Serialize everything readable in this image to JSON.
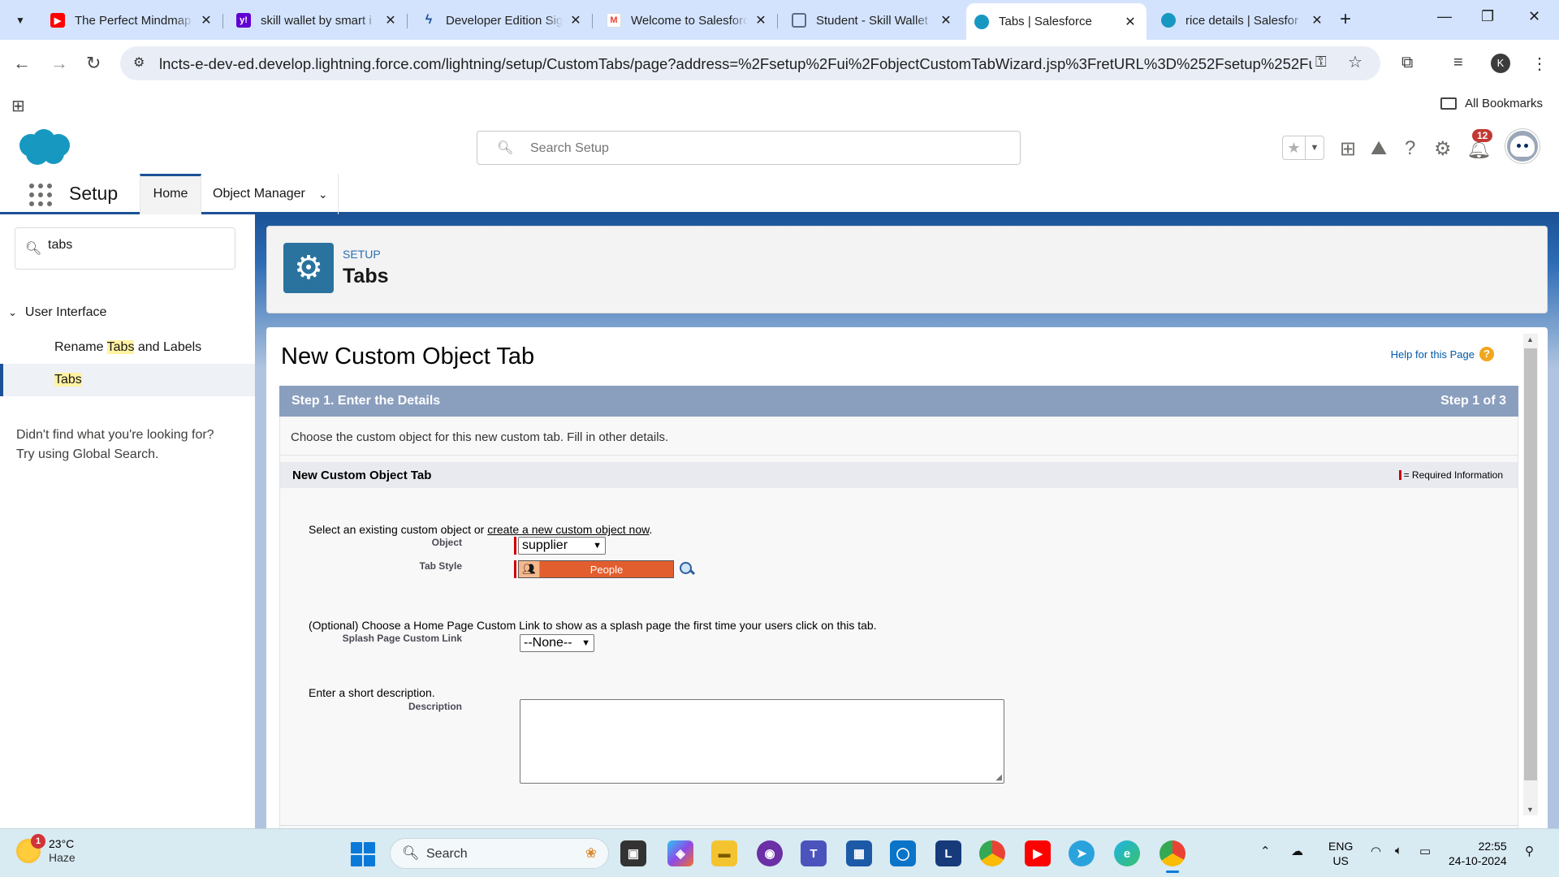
{
  "browser": {
    "tabs": [
      {
        "title": "The Perfect Mindmap",
        "icon": "youtube-icon",
        "color": "#ff0000"
      },
      {
        "title": "skill wallet by smart i",
        "icon": "yahoo-icon",
        "color": "#6001d2"
      },
      {
        "title": "Developer Edition Sig",
        "icon": "bolt-icon",
        "color": "#1b5297"
      },
      {
        "title": "Welcome to Salesforc",
        "icon": "gmail-icon",
        "color": "#ea4335"
      },
      {
        "title": "Student - Skill Wallet",
        "icon": "page-icon",
        "color": "#5a6b8c"
      },
      {
        "title": "Tabs | Salesforce",
        "icon": "salesforce-cloud-icon",
        "color": "#1798c1",
        "active": true
      },
      {
        "title": "rice details | Salesfor",
        "icon": "salesforce-cloud-icon",
        "color": "#1798c1"
      }
    ],
    "url": "lncts-e-dev-ed.develop.lightning.force.com/lightning/setup/CustomTabs/page?address=%2Fsetup%2Fui%2FobjectCustomTabWizard.jsp%3FretURL%3D%252Fsetup%252Fui%252Fc...",
    "profile_initial": "K",
    "all_bookmarks": "All Bookmarks"
  },
  "sf_header": {
    "search_placeholder": "Search Setup",
    "notifications_count": "12"
  },
  "sf_nav": {
    "app_name": "Setup",
    "home": "Home",
    "object_manager": "Object Manager"
  },
  "sidebar": {
    "quick_find_value": "tabs",
    "section": "User Interface",
    "items": [
      {
        "pre": "Rename ",
        "hl": "Tabs",
        "post": " and Labels"
      },
      {
        "pre": "",
        "hl": "Tabs",
        "post": ""
      }
    ],
    "not_found_1": "Didn't find what you're looking for?",
    "not_found_2": "Try using Global Search."
  },
  "page_header": {
    "eyebrow": "SETUP",
    "title": "Tabs"
  },
  "form": {
    "page_title": "New Custom Object Tab",
    "help_link": "Help for this Page",
    "step_title": "Step 1. Enter the Details",
    "step_count": "Step 1 of 3",
    "intro": "Choose the custom object for this new custom tab. Fill in other details.",
    "section_title": "New Custom Object Tab",
    "required_info": "= Required Information",
    "select_prefix": "Select an existing custom object or ",
    "select_link": "create a new custom object now",
    "select_suffix": ".",
    "object_label": "Object",
    "object_value": "supplier",
    "tab_style_label": "Tab Style",
    "tab_style_value": "People",
    "tab_style_color": "#e35e2e",
    "splash_text": "(Optional) Choose a Home Page Custom Link to show as a splash page the first time your users click on this tab.",
    "splash_label": "Splash Page Custom Link",
    "splash_value": "--None--",
    "desc_text": "Enter a short description.",
    "desc_label": "Description",
    "desc_value": ""
  },
  "taskbar": {
    "temperature": "23°C",
    "weather": "Haze",
    "weather_badge": "1",
    "search": "Search",
    "lang1": "ENG",
    "lang2": "US",
    "time": "22:55",
    "date": "24-10-2024"
  }
}
